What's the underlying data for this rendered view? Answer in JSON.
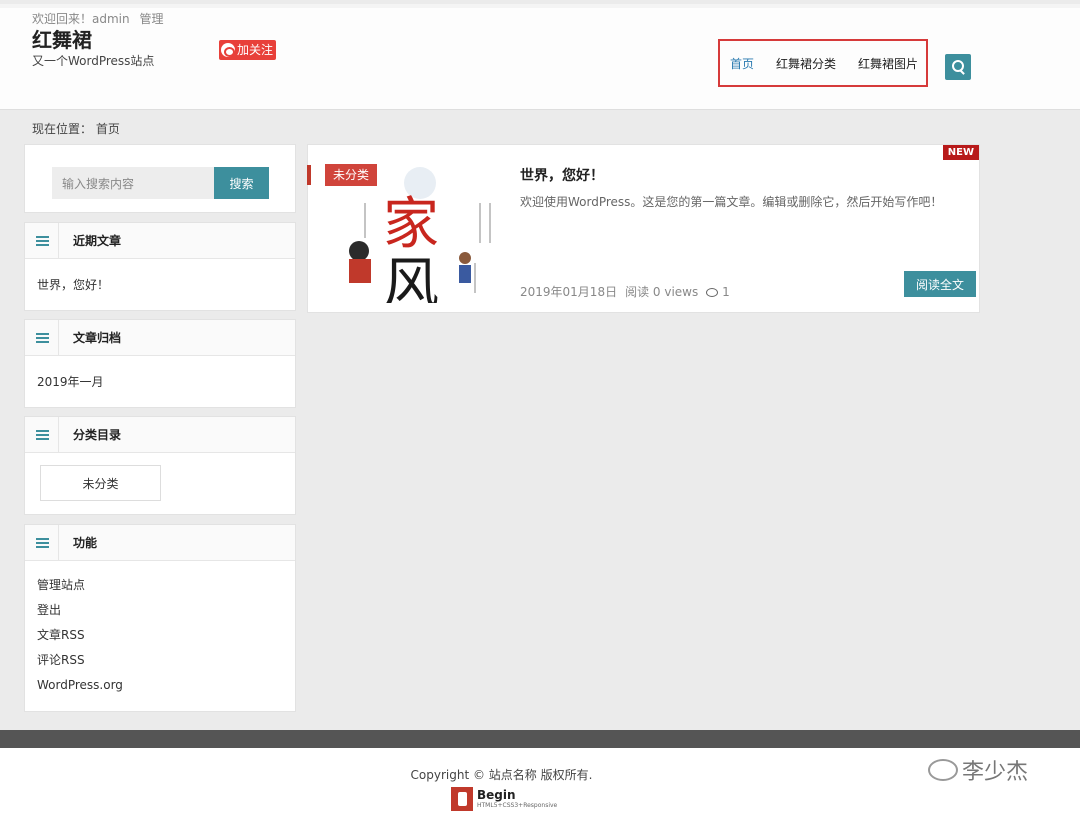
{
  "header": {
    "welcome": "欢迎回来！admin",
    "manage_link": "管理",
    "site_title": "红舞裙",
    "site_desc": "又一个WordPress站点",
    "weibo_follow": "加关注"
  },
  "nav": {
    "items": [
      {
        "label": "首页"
      },
      {
        "label": "红舞裙分类"
      },
      {
        "label": "红舞裙图片"
      }
    ]
  },
  "breadcrumb": "现在位置： 首页",
  "sidebar": {
    "search": {
      "placeholder": "输入搜索内容",
      "button": "搜索"
    },
    "recent_posts": {
      "title": "近期文章",
      "items": [
        "世界，您好！"
      ]
    },
    "archives": {
      "title": "文章归档",
      "items": [
        "2019年一月"
      ]
    },
    "categories": {
      "title": "分类目录",
      "items": [
        "未分类"
      ]
    },
    "functions": {
      "title": "功能",
      "items": [
        "管理站点",
        "登出",
        "文章RSS",
        "评论RSS",
        "WordPress.org"
      ]
    }
  },
  "post": {
    "category": "未分类",
    "badge": "NEW",
    "title": "世界，您好！",
    "excerpt": "欢迎使用WordPress。这是您的第一篇文章。编辑或删除它，然后开始写作吧！",
    "date": "2019年01月18日",
    "views": "阅读 0 views",
    "comments": "1",
    "read_more": "阅读全文",
    "thumb_text_1": "家",
    "thumb_text_2": "风"
  },
  "footer": {
    "copyright": "Copyright ©  站点名称  版权所有.",
    "logo_title": "Begin",
    "logo_sub": "HTML5+CSS3+Responsive",
    "watermark": "李少杰"
  },
  "colors": {
    "accent": "#3d8f9d",
    "red": "#d0443b",
    "nav_highlight": "#d63a3a"
  }
}
